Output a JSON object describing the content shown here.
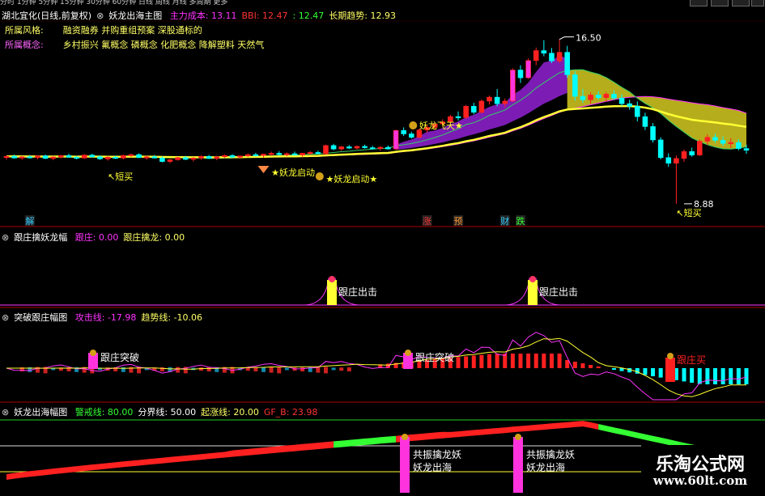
{
  "top_menu": "分时 1分钟 5分钟 15分钟 30分钟 60分钟 日线 周线 月线 多周期 更多",
  "colors": {
    "bg": "#000000",
    "axis": "#aa0000",
    "up": "#ff2020",
    "down": "#00ffff",
    "yellow": "#ffff33",
    "purple": "#cc33ff",
    "magenta": "#ff33ff",
    "green": "#33ff33",
    "white": "#ffffff",
    "gold": "#ddcc33"
  },
  "main": {
    "stock": "湖北宜化(日线,前复权)",
    "indicator": "妖龙出海主图",
    "params": [
      {
        "label": "主力成本:",
        "value": "13.11",
        "color": "#ff33ff"
      },
      {
        "label": "BBI:",
        "value": "12.47",
        "color": "#ff3333"
      },
      {
        "label": ":",
        "value": "12.47",
        "color": "#33ff33"
      },
      {
        "label": "长期趋势:",
        "value": "12.93",
        "color": "#ffff66"
      }
    ],
    "info": [
      {
        "label": "所属风格:",
        "value": "融资融券 并购重组预案 深股通标的",
        "label_color": "#ffff66"
      },
      {
        "label": "所属概念:",
        "value": "乡村振兴 氟概念 磷概念 化肥概念 降解塑料 天然气",
        "label_color": "#ff66ff"
      }
    ],
    "high_label": "16.50",
    "low_label": "8.88",
    "events": [
      "解",
      "涨",
      "预",
      "财",
      "跌"
    ],
    "signals": {
      "chaomai1": "短买",
      "qidong1": "妖龙启动",
      "qidong2": "妖龙启动",
      "feitian": "妖龙飞天",
      "chaomai2": "短买"
    }
  },
  "panel2": {
    "title": "跟庄擒妖龙幅",
    "params": [
      {
        "label": "跟庄:",
        "value": "0.00",
        "color": "#ff33ff"
      },
      {
        "label": "跟庄擒龙:",
        "value": "0.00",
        "color": "#ffff66"
      }
    ],
    "signal_label": "跟庄出击"
  },
  "panel3": {
    "title": "突破跟庄幅图",
    "params": [
      {
        "label": "攻击线:",
        "value": "-17.98",
        "color": "#ff33ff"
      },
      {
        "label": "趋势线:",
        "value": "-10.06",
        "color": "#ffff66"
      }
    ],
    "signal_break": "跟庄突破",
    "signal_buy": "跟庄买"
  },
  "panel4": {
    "title": "妖龙出海幅图",
    "params": [
      {
        "label": "警戒线:",
        "value": "80.00",
        "color": "#33ff33"
      },
      {
        "label": "分界线:",
        "value": "50.00",
        "color": "#ffffff"
      },
      {
        "label": "起涨线:",
        "value": "20.00",
        "color": "#ffff66"
      },
      {
        "label": "GF_B:",
        "value": "23.98",
        "color": "#ff3333"
      }
    ],
    "label_a": "共振擒龙妖",
    "label_b": "妖龙出海"
  },
  "watermark": {
    "name": "乐淘公式网",
    "url": "www.60lt.com"
  },
  "chart_data": {
    "type": "candlestick",
    "ylim": [
      8.5,
      17.2
    ],
    "candles": [
      [
        11.02,
        11.12,
        10.92,
        11.08
      ],
      [
        11.08,
        11.16,
        10.98,
        11.0
      ],
      [
        11.0,
        11.1,
        10.92,
        11.06
      ],
      [
        11.06,
        11.14,
        10.98,
        11.02
      ],
      [
        11.02,
        11.12,
        10.94,
        11.1
      ],
      [
        11.1,
        11.16,
        10.96,
        10.98
      ],
      [
        10.98,
        11.08,
        10.9,
        11.05
      ],
      [
        11.05,
        11.14,
        10.98,
        11.12
      ],
      [
        11.12,
        11.2,
        11.02,
        11.04
      ],
      [
        11.04,
        11.1,
        10.94,
        11.0
      ],
      [
        11.0,
        11.18,
        10.96,
        11.14
      ],
      [
        11.14,
        11.2,
        11.02,
        11.06
      ],
      [
        11.06,
        11.12,
        10.92,
        10.96
      ],
      [
        10.96,
        11.08,
        10.88,
        11.04
      ],
      [
        11.04,
        11.12,
        10.96,
        11.0
      ],
      [
        11.0,
        11.16,
        10.94,
        11.12
      ],
      [
        11.12,
        11.2,
        11.06,
        11.16
      ],
      [
        11.16,
        11.22,
        11.0,
        11.02
      ],
      [
        11.02,
        11.1,
        10.92,
        11.06
      ],
      [
        11.06,
        11.14,
        10.98,
        11.0
      ],
      [
        11.0,
        11.08,
        10.8,
        10.84
      ],
      [
        10.84,
        10.96,
        10.76,
        10.92
      ],
      [
        10.92,
        11.06,
        10.88,
        11.02
      ],
      [
        11.02,
        11.1,
        10.9,
        10.94
      ],
      [
        10.94,
        11.04,
        10.84,
        11.0
      ],
      [
        11.0,
        11.12,
        10.92,
        11.08
      ],
      [
        11.08,
        11.14,
        10.96,
        10.98
      ],
      [
        10.98,
        11.1,
        10.9,
        11.06
      ],
      [
        11.06,
        11.16,
        11.0,
        11.12
      ],
      [
        11.12,
        11.18,
        11.02,
        11.04
      ],
      [
        11.04,
        11.12,
        10.96,
        11.1
      ],
      [
        11.1,
        11.2,
        11.04,
        11.16
      ],
      [
        11.16,
        11.24,
        11.08,
        11.12
      ],
      [
        11.12,
        11.2,
        11.02,
        11.18
      ],
      [
        11.18,
        11.3,
        11.1,
        11.22
      ],
      [
        11.22,
        11.32,
        11.12,
        11.16
      ],
      [
        11.16,
        11.26,
        11.08,
        11.2
      ],
      [
        11.2,
        11.3,
        11.12,
        11.14
      ],
      [
        11.14,
        11.24,
        11.06,
        11.22
      ],
      [
        11.22,
        11.32,
        11.16,
        11.26
      ],
      [
        11.26,
        11.34,
        11.18,
        11.2
      ],
      [
        11.2,
        11.62,
        11.16,
        11.58
      ],
      [
        11.58,
        11.66,
        11.36,
        11.42
      ],
      [
        11.42,
        11.56,
        11.34,
        11.52
      ],
      [
        11.52,
        11.6,
        11.42,
        11.46
      ],
      [
        11.46,
        11.58,
        11.4,
        11.54
      ],
      [
        11.54,
        11.62,
        11.44,
        11.48
      ],
      [
        11.48,
        11.56,
        11.4,
        11.44
      ],
      [
        11.44,
        11.54,
        11.34,
        11.5
      ],
      [
        11.5,
        11.58,
        11.4,
        11.42
      ],
      [
        11.42,
        12.32,
        11.38,
        12.28
      ],
      [
        12.28,
        12.42,
        12.02,
        12.12
      ],
      [
        12.12,
        12.22,
        11.9,
        11.96
      ],
      [
        11.96,
        12.36,
        11.92,
        12.3
      ],
      [
        12.3,
        12.52,
        12.18,
        12.42
      ],
      [
        12.42,
        12.66,
        12.3,
        12.58
      ],
      [
        12.58,
        12.8,
        12.46,
        12.68
      ],
      [
        12.68,
        13.0,
        12.6,
        12.92
      ],
      [
        12.92,
        13.16,
        12.74,
        12.88
      ],
      [
        12.88,
        13.46,
        12.82,
        13.4
      ],
      [
        13.4,
        13.56,
        13.02,
        13.12
      ],
      [
        13.12,
        13.72,
        13.06,
        13.64
      ],
      [
        13.64,
        13.9,
        13.48,
        13.82
      ],
      [
        13.82,
        14.2,
        13.4,
        13.52
      ],
      [
        13.52,
        13.76,
        13.36,
        13.64
      ],
      [
        13.64,
        15.16,
        13.6,
        15.08
      ],
      [
        15.08,
        15.3,
        14.48,
        14.72
      ],
      [
        14.72,
        15.62,
        14.66,
        15.52
      ],
      [
        15.52,
        16.12,
        15.3,
        15.98
      ],
      [
        15.98,
        16.46,
        15.72,
        15.86
      ],
      [
        15.86,
        16.1,
        15.4,
        15.5
      ],
      [
        15.5,
        16.5,
        15.4,
        15.9
      ],
      [
        15.9,
        16.2,
        14.72,
        14.86
      ],
      [
        14.86,
        15.02,
        13.66,
        13.86
      ],
      [
        13.86,
        14.2,
        13.56,
        13.7
      ],
      [
        13.7,
        14.04,
        13.52,
        13.92
      ],
      [
        13.92,
        14.1,
        13.7,
        13.8
      ],
      [
        13.8,
        14.06,
        13.62,
        13.96
      ],
      [
        13.96,
        14.14,
        13.7,
        13.78
      ],
      [
        13.78,
        13.96,
        13.4,
        13.52
      ],
      [
        13.52,
        13.7,
        13.24,
        13.4
      ],
      [
        13.4,
        13.62,
        12.7,
        12.92
      ],
      [
        12.92,
        13.1,
        12.3,
        12.46
      ],
      [
        12.46,
        12.62,
        11.72,
        11.84
      ],
      [
        11.84,
        11.96,
        10.94,
        11.02
      ],
      [
        11.02,
        11.22,
        10.6,
        10.76
      ],
      [
        10.76,
        11.12,
        8.88,
        10.98
      ],
      [
        10.98,
        11.4,
        10.82,
        11.3
      ],
      [
        11.3,
        11.48,
        11.06,
        11.14
      ],
      [
        11.14,
        11.86,
        11.1,
        11.78
      ],
      [
        11.78,
        12.1,
        11.6,
        11.96
      ],
      [
        11.96,
        12.14,
        11.7,
        11.82
      ],
      [
        11.82,
        12.0,
        11.56,
        11.68
      ],
      [
        11.68,
        11.92,
        11.46,
        11.72
      ],
      [
        11.72,
        11.88,
        11.36,
        11.44
      ],
      [
        11.44,
        11.62,
        11.2,
        11.36
      ]
    ]
  }
}
